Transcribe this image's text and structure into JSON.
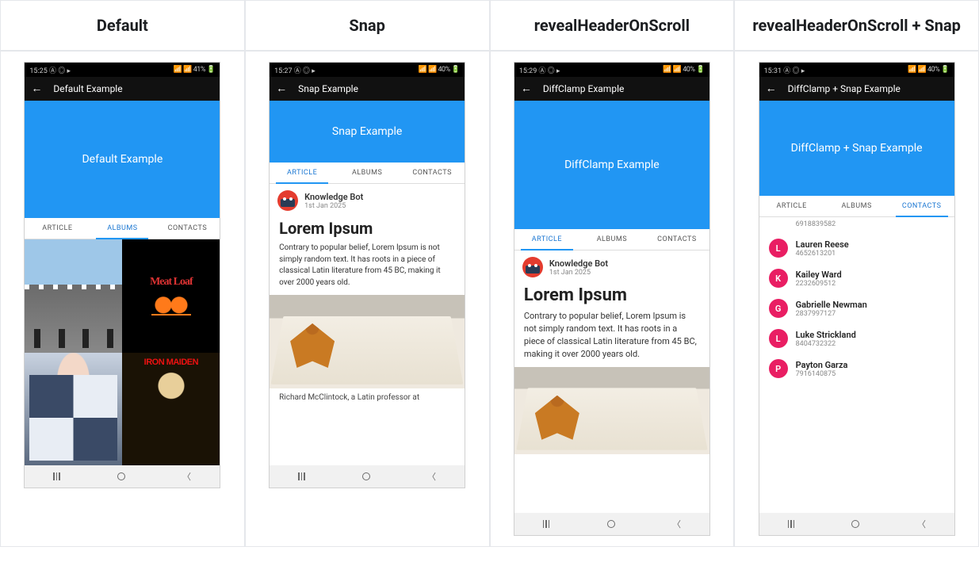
{
  "columns": {
    "c1": "Default",
    "c2": "Snap",
    "c3": "revealHeaderOnScroll",
    "c4": "revealHeaderOnScroll + Snap"
  },
  "tabs": {
    "article": "ARTICLE",
    "albums": "ALBUMS",
    "contacts": "CONTACTS"
  },
  "status": {
    "t1": "15:25",
    "t2": "15:27",
    "t3": "15:29",
    "t4": "15:31",
    "icons": "Ⓐ ◎ ▸",
    "r1": "📶 📶 41% 🔋",
    "r2": "📶 📶 40% 🔋",
    "r3": "📶 📶 40% 🔋",
    "r4": "📶 📶 40% 🔋"
  },
  "appbar": {
    "t1": "Default Example",
    "t2": "Snap Example",
    "t3": "DiffClamp Example",
    "t4": "DiffClamp + Snap Example"
  },
  "hero": {
    "t1": "Default Example",
    "t2": "Snap Example",
    "t3": "DiffClamp Example",
    "t4": "DiffClamp + Snap Example"
  },
  "article": {
    "author": "Knowledge Bot",
    "date": "1st Jan 2025",
    "title": "Lorem Ipsum",
    "body": "Contrary to popular belief, Lorem Ipsum is not simply random text. It has roots in a piece of classical Latin literature from 45 BC, making it over 2000 years old.",
    "footnote": "Richard McClintock, a Latin professor at"
  },
  "albums": {
    "meatloaf": "Meat Loaf",
    "ironmaiden": "IRON MAIDEN"
  },
  "contacts": {
    "partial_num": "6918839582",
    "items": [
      {
        "initial": "L",
        "name": "Lauren Reese",
        "num": "4652613201"
      },
      {
        "initial": "K",
        "name": "Kailey Ward",
        "num": "2232609512"
      },
      {
        "initial": "G",
        "name": "Gabrielle Newman",
        "num": "2837997127"
      },
      {
        "initial": "L",
        "name": "Luke Strickland",
        "num": "8404732322"
      },
      {
        "initial": "P",
        "name": "Payton Garza",
        "num": "7916140875"
      }
    ]
  }
}
